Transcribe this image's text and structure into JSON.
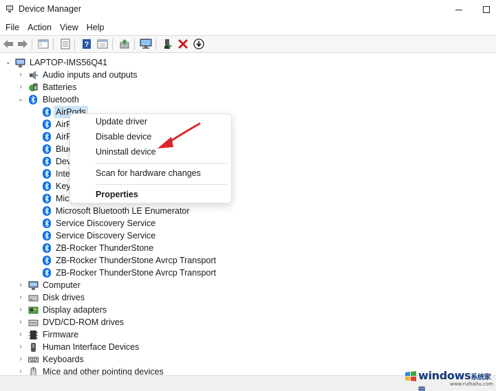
{
  "window": {
    "title": "Device Manager"
  },
  "menubar": {
    "items": [
      "File",
      "Action",
      "View",
      "Help"
    ]
  },
  "toolbar": {
    "buttons": [
      "back-icon",
      "forward-icon",
      "show-hide-console-tree-icon",
      "properties-icon",
      "help-icon",
      "view-icon",
      "update-driver-icon",
      "scan-hardware-icon",
      "enable-device-icon",
      "uninstall-device-icon",
      "download-icon"
    ]
  },
  "tree": {
    "root": "LAPTOP-IMS56Q41",
    "categories": {
      "audio": "Audio inputs and outputs",
      "batteries": "Batteries",
      "bluetooth": "Bluetooth",
      "computer": "Computer",
      "disk": "Disk drives",
      "display": "Display adapters",
      "dvd": "DVD/CD-ROM drives",
      "firmware": "Firmware",
      "hid": "Human Interface Devices",
      "keyboards": "Keyboards",
      "mice": "Mice and other pointing devices"
    },
    "bluetooth_children": [
      "AirPods",
      "AirP",
      "AirP",
      "Blue",
      "Dev",
      "Inte",
      "Key",
      "Mic",
      "Microsoft Bluetooth LE Enumerator",
      "Service Discovery Service",
      "Service Discovery Service",
      "ZB-Rocker ThunderStone",
      "ZB-Rocker ThunderStone Avrcp Transport",
      "ZB-Rocker ThunderStone Avrcp Transport"
    ]
  },
  "context_menu": {
    "update_driver": "Update driver",
    "disable_device": "Disable device",
    "uninstall_device": "Uninstall device",
    "scan_hardware": "Scan for hardware changes",
    "properties": "Properties"
  },
  "watermark": {
    "brand": "windows",
    "brand_suffix": "系统家园",
    "url": "www.ruihaitu.com"
  },
  "colors": {
    "bluetooth_blue": "#0a6ee6",
    "selection": "#cde4f7",
    "arrow_red": "#d9252a",
    "uninstall_red": "#d11a1a"
  }
}
